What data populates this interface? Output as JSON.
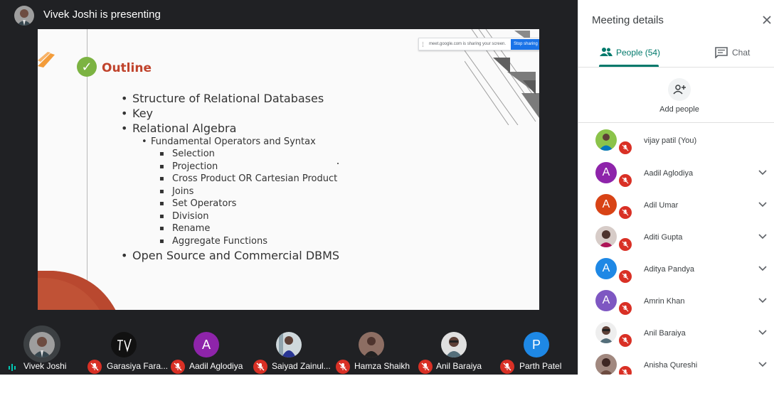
{
  "presenter": {
    "title": "Vivek Joshi is presenting"
  },
  "slide": {
    "title": "Outline",
    "bullets_l1": [
      "Structure of Relational Databases",
      "Key",
      "Relational Algebra",
      "Open Source and Commercial DBMS"
    ],
    "bullet_l2": "Fundamental Operators and Syntax",
    "bullets_l3": [
      "Selection",
      "Projection",
      "Cross Product OR Cartesian Product",
      "Joins",
      "Set Operators",
      "Division",
      "Rename",
      "Aggregate Functions"
    ],
    "share_banner_text": "meet.google.com is sharing your screen.",
    "stop_sharing_label": "Stop sharing"
  },
  "strip": {
    "tiles": [
      {
        "name": "Vivek Joshi",
        "type": "photo",
        "muted": false,
        "speaking": true
      },
      {
        "name": "Garasiya Fara...",
        "type": "photo",
        "muted": true
      },
      {
        "name": "Aadil Aglodiya",
        "type": "letter",
        "letter": "A",
        "color": "#8e24aa",
        "muted": true
      },
      {
        "name": "Saiyad Zainul...",
        "type": "photo",
        "muted": true
      },
      {
        "name": "Hamza Shaikh",
        "type": "photo",
        "muted": true
      },
      {
        "name": "Anil Baraiya",
        "type": "photo",
        "muted": true
      },
      {
        "name": "Parth Patel",
        "type": "letter",
        "letter": "P",
        "color": "#1e88e5",
        "muted": true
      }
    ]
  },
  "panel": {
    "title": "Meeting details",
    "tabs": {
      "people": "People (54)",
      "chat": "Chat"
    },
    "add_people_label": "Add people",
    "participants": [
      {
        "name": "vijay patil (You)",
        "type": "photo",
        "expandable": false
      },
      {
        "name": "Aadil Aglodiya",
        "type": "letter",
        "letter": "A",
        "color": "#8e24aa",
        "expandable": true
      },
      {
        "name": "Adil Umar",
        "type": "letter",
        "letter": "A",
        "color": "#d84315",
        "expandable": true
      },
      {
        "name": "Aditi Gupta",
        "type": "photo",
        "expandable": true
      },
      {
        "name": "Aditya Pandya",
        "type": "letter",
        "letter": "A",
        "color": "#1e88e5",
        "expandable": true
      },
      {
        "name": "Amrin Khan",
        "type": "letter",
        "letter": "A",
        "color": "#7e57c2",
        "expandable": true
      },
      {
        "name": "Anil Baraiya",
        "type": "photo",
        "expandable": true
      },
      {
        "name": "Anisha Qureshi",
        "type": "photo",
        "expandable": true
      }
    ]
  },
  "colors": {
    "stage_bg": "#202124",
    "accent_teal": "#00796b",
    "mute_red": "#d93025",
    "outline_title": "#c0432c",
    "check_green": "#7cb342"
  }
}
